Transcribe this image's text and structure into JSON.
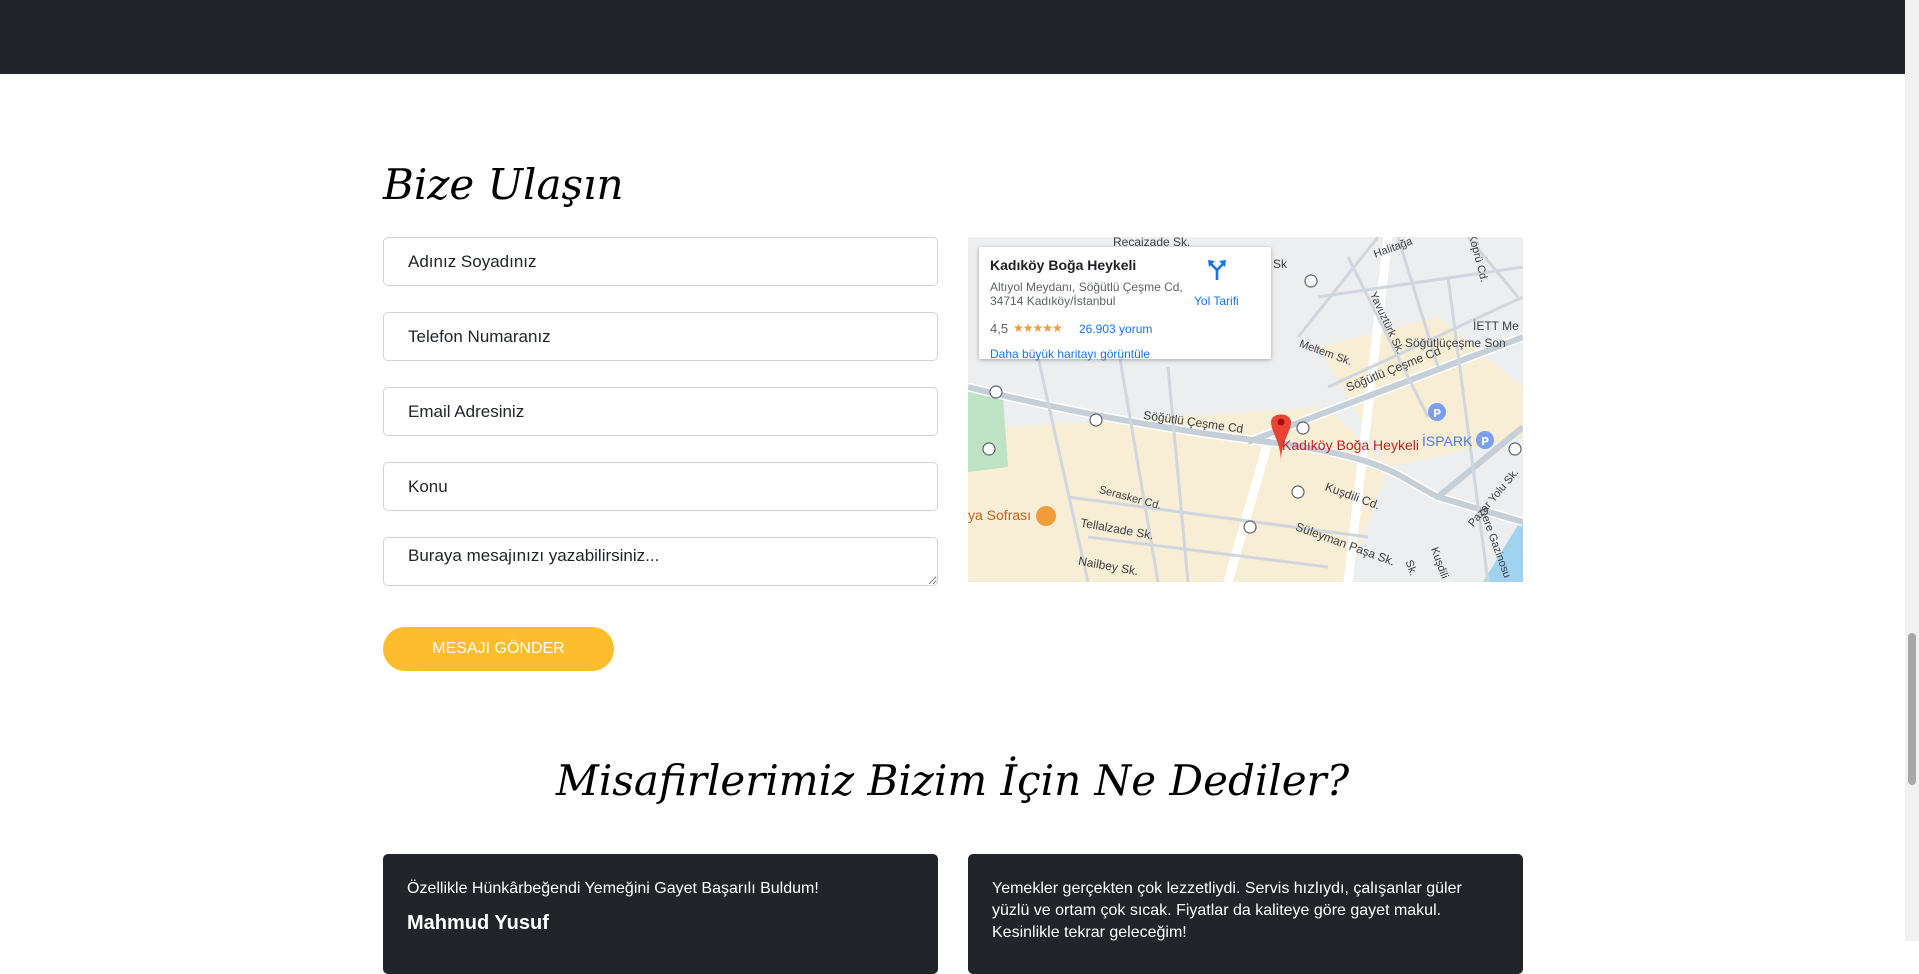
{
  "contact": {
    "title": "Bize Ulaşın",
    "name_placeholder": "Adınız Soyadınız",
    "phone_placeholder": "Telefon Numaranız",
    "email_placeholder": "Email Adresiniz",
    "subject_placeholder": "Konu",
    "message_placeholder": "Buraya mesajınızı yazabilirsiniz...",
    "send_label": "MESAJI GÖNDER"
  },
  "map": {
    "place_name": "Kadıköy Boğa Heykeli",
    "address": "Altıyol Meydanı, Söğütlü Çeşme Cd, 34714 Kadıköy/İstanbul",
    "rating": "4,5",
    "stars": "★★★★★",
    "reviews": "26.903 yorum",
    "larger_map": "Daha büyük haritayı görüntüle",
    "directions": "Yol Tarifi",
    "pin_label": "Kadıköy Boğa Heykeli",
    "ispark_label": "İSPARK",
    "restaurant_label": "ya Sofrası",
    "streets": [
      "Recaizade Sk.",
      "Söğütlü Çeşme Cd",
      "Söğütlü Çeşme Cd",
      "Kuşdili Cd.",
      "Serasker Cd.",
      "Tellalzade Sk.",
      "Süleyman Paşa Sk.",
      "Nailbey Sk.",
      "Meltem Sk.",
      "Yavuztürk Sk.",
      "Söğütlüçeşme Son",
      "İETT Me",
      "Pazar Yolu Sk.",
      "Dere Gazinosu",
      "Halitağa",
      "Köprü Cd.",
      "Sk",
      "Kuşdili",
      "Sk."
    ]
  },
  "testimonials": {
    "title": "Misafirlerimiz Bizim İçin Ne Dediler?",
    "items": [
      {
        "text": "Özellikle Hünkârbeğendi Yemeğini Gayet Başarılı Buldum!",
        "author": "Mahmud Yusuf"
      },
      {
        "text": "Yemekler gerçekten çok lezzetliydi. Servis hızlıydı, çalışanlar güler yüzlü ve ortam çok sıcak. Fiyatlar da kaliteye göre gayet makul. Kesinlikle tekrar geleceğim!",
        "author": ""
      }
    ]
  }
}
